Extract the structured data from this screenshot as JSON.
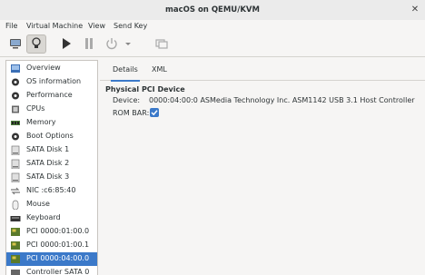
{
  "window": {
    "title": "macOS on QEMU/KVM"
  },
  "menu": [
    "File",
    "Virtual Machine",
    "View",
    "Send Key"
  ],
  "toolbar": {
    "icons": [
      "monitor-icon",
      "lightbulb-icon",
      "play-icon",
      "pause-icon",
      "power-icon",
      "chevron-down-icon",
      "snapshot-icon"
    ]
  },
  "sidebar": {
    "items": [
      {
        "label": "Overview",
        "icon": "overview-icon"
      },
      {
        "label": "OS information",
        "icon": "gear-icon"
      },
      {
        "label": "Performance",
        "icon": "gear-icon"
      },
      {
        "label": "CPUs",
        "icon": "cpu-icon"
      },
      {
        "label": "Memory",
        "icon": "memory-icon"
      },
      {
        "label": "Boot Options",
        "icon": "gear-icon"
      },
      {
        "label": "SATA Disk 1",
        "icon": "disk-icon"
      },
      {
        "label": "SATA Disk 2",
        "icon": "disk-icon"
      },
      {
        "label": "SATA Disk 3",
        "icon": "disk-icon"
      },
      {
        "label": "NIC :c6:85:40",
        "icon": "network-icon"
      },
      {
        "label": "Mouse",
        "icon": "mouse-icon"
      },
      {
        "label": "Keyboard",
        "icon": "keyboard-icon"
      },
      {
        "label": "PCI 0000:01:00.0",
        "icon": "pci-icon"
      },
      {
        "label": "PCI 0000:01:00.1",
        "icon": "pci-icon"
      },
      {
        "label": "PCI 0000:04:00.0",
        "icon": "pci-icon",
        "selected": true
      },
      {
        "label": "Controller SATA 0",
        "icon": "controller-icon"
      }
    ]
  },
  "tabs": [
    {
      "label": "Details",
      "active": true
    },
    {
      "label": "XML",
      "active": false
    }
  ],
  "details": {
    "section_title": "Physical PCI Device",
    "device_label": "Device:",
    "device_value": "0000:04:00:0 ASMedia Technology Inc. ASM1142 USB 3.1 Host Controller",
    "rombar_label": "ROM BAR:",
    "rombar_checked": true
  },
  "colors": {
    "accent": "#3b79c9"
  }
}
